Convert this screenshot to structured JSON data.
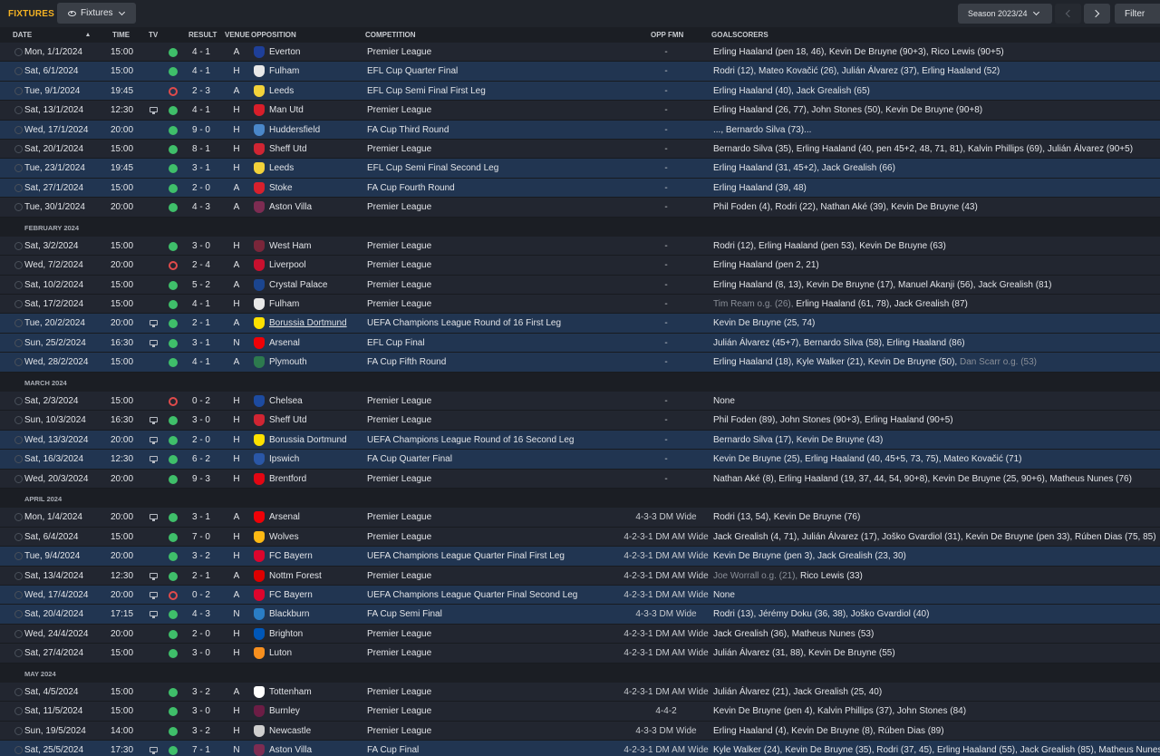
{
  "topbar": {
    "title": "FIXTURES",
    "view_dropdown": "Fixtures",
    "season": "Season 2023/24",
    "filter": "Filter"
  },
  "columns": {
    "date": "DATE",
    "time": "TIME",
    "tv": "TV",
    "result": "RESULT",
    "venue": "VENUE",
    "opposition": "OPPOSITION",
    "competition": "COMPETITION",
    "opp_fmn": "OPP FMN",
    "goalscorers": "GOALSCORERS"
  },
  "team_colors": {
    "Everton": "#1e3f99",
    "Fulham": "#e8e8e8",
    "Leeds": "#f2d23a",
    "Man Utd": "#d81e2a",
    "Huddersfield": "#4a87c9",
    "Sheff Utd": "#d02533",
    "Stoke": "#d8202d",
    "Aston Villa": "#7d2c52",
    "West Ham": "#7a263a",
    "Liverpool": "#c8102e",
    "Crystal Palace": "#1b458f",
    "Borussia Dortmund": "#fde100",
    "Arsenal": "#ef0107",
    "Plymouth": "#2d7a4e",
    "Chelsea": "#1d4ba0",
    "Ipswich": "#2a57a7",
    "Brentford": "#e30613",
    "Wolves": "#fdb913",
    "FC Bayern": "#dc052d",
    "Nottm Forest": "#dd0000",
    "Blackburn": "#2a7dc4",
    "Brighton": "#0057b8",
    "Luton": "#f78f1e",
    "Tottenham": "#ffffff",
    "Burnley": "#6c1d45",
    "Newcastle": "#cfcfcf"
  },
  "fixtures": [
    {
      "type": "match",
      "date": "Mon, 1/1/2024",
      "time": "15:00",
      "tv": false,
      "outcome": "W",
      "score": "4 - 1",
      "venue": "A",
      "opposition": "Everton",
      "competition": "Premier League",
      "opp_fmn": "-",
      "scorers": "Erling Haaland (pen 18, 46), Kevin De Bruyne (90+3), Rico Lewis (90+5)",
      "og": "",
      "scorers_after": "",
      "highlight": false
    },
    {
      "type": "match",
      "date": "Sat, 6/1/2024",
      "time": "15:00",
      "tv": false,
      "outcome": "W",
      "score": "4 - 1",
      "venue": "H",
      "opposition": "Fulham",
      "competition": "EFL Cup Quarter Final",
      "opp_fmn": "-",
      "scorers": "Rodri (12), Mateo Kovačić (26), Julián Álvarez (37), Erling Haaland (52)",
      "og": "",
      "scorers_after": "",
      "highlight": true
    },
    {
      "type": "match",
      "date": "Tue, 9/1/2024",
      "time": "19:45",
      "tv": false,
      "outcome": "L",
      "score": "2 - 3",
      "venue": "A",
      "opposition": "Leeds",
      "competition": "EFL Cup Semi Final First Leg",
      "opp_fmn": "-",
      "scorers": "Erling Haaland (40), Jack Grealish (65)",
      "og": "",
      "scorers_after": "",
      "highlight": true
    },
    {
      "type": "match",
      "date": "Sat, 13/1/2024",
      "time": "12:30",
      "tv": true,
      "outcome": "W",
      "score": "4 - 1",
      "venue": "H",
      "opposition": "Man Utd",
      "competition": "Premier League",
      "opp_fmn": "-",
      "scorers": "Erling Haaland (26, 77), John Stones (50), Kevin De Bruyne (90+8)",
      "og": "",
      "scorers_after": "",
      "highlight": false
    },
    {
      "type": "match",
      "date": "Wed, 17/1/2024",
      "time": "20:00",
      "tv": false,
      "outcome": "W",
      "score": "9 - 0",
      "venue": "H",
      "opposition": "Huddersfield",
      "competition": "FA Cup Third Round",
      "opp_fmn": "-",
      "scorers": "..., Bernardo Silva (73)...",
      "og": "",
      "scorers_after": "",
      "highlight": true
    },
    {
      "type": "match",
      "date": "Sat, 20/1/2024",
      "time": "15:00",
      "tv": false,
      "outcome": "W",
      "score": "8 - 1",
      "venue": "H",
      "opposition": "Sheff Utd",
      "competition": "Premier League",
      "opp_fmn": "-",
      "scorers": "Bernardo Silva (35), Erling Haaland (40, pen 45+2, 48, 71, 81), Kalvin Phillips (69), Julián Álvarez (90+5)",
      "og": "",
      "scorers_after": "",
      "highlight": false
    },
    {
      "type": "match",
      "date": "Tue, 23/1/2024",
      "time": "19:45",
      "tv": false,
      "outcome": "W",
      "score": "3 - 1",
      "venue": "H",
      "opposition": "Leeds",
      "competition": "EFL Cup Semi Final Second Leg",
      "opp_fmn": "-",
      "scorers": "Erling Haaland (31, 45+2), Jack Grealish (66)",
      "og": "",
      "scorers_after": "",
      "highlight": true
    },
    {
      "type": "match",
      "date": "Sat, 27/1/2024",
      "time": "15:00",
      "tv": false,
      "outcome": "W",
      "score": "2 - 0",
      "venue": "A",
      "opposition": "Stoke",
      "competition": "FA Cup Fourth Round",
      "opp_fmn": "-",
      "scorers": "Erling Haaland (39, 48)",
      "og": "",
      "scorers_after": "",
      "highlight": true
    },
    {
      "type": "match",
      "date": "Tue, 30/1/2024",
      "time": "20:00",
      "tv": false,
      "outcome": "W",
      "score": "4 - 3",
      "venue": "A",
      "opposition": "Aston Villa",
      "competition": "Premier League",
      "opp_fmn": "-",
      "scorers": "Phil Foden (4), Rodri (22), Nathan Aké (39), Kevin De Bruyne (43)",
      "og": "",
      "scorers_after": "",
      "highlight": false
    },
    {
      "type": "month",
      "label": "FEBRUARY 2024"
    },
    {
      "type": "match",
      "date": "Sat, 3/2/2024",
      "time": "15:00",
      "tv": false,
      "outcome": "W",
      "score": "3 - 0",
      "venue": "H",
      "opposition": "West Ham",
      "competition": "Premier League",
      "opp_fmn": "-",
      "scorers": "Rodri (12), Erling Haaland (pen 53), Kevin De Bruyne (63)",
      "og": "",
      "scorers_after": "",
      "highlight": false
    },
    {
      "type": "match",
      "date": "Wed, 7/2/2024",
      "time": "20:00",
      "tv": false,
      "outcome": "L",
      "score": "2 - 4",
      "venue": "A",
      "opposition": "Liverpool",
      "competition": "Premier League",
      "opp_fmn": "-",
      "scorers": "Erling Haaland (pen 2, 21)",
      "og": "",
      "scorers_after": "",
      "highlight": false
    },
    {
      "type": "match",
      "date": "Sat, 10/2/2024",
      "time": "15:00",
      "tv": false,
      "outcome": "W",
      "score": "5 - 2",
      "venue": "A",
      "opposition": "Crystal Palace",
      "competition": "Premier League",
      "opp_fmn": "-",
      "scorers": "Erling Haaland (8, 13), Kevin De Bruyne (17), Manuel Akanji (56), Jack Grealish (81)",
      "og": "",
      "scorers_after": "",
      "highlight": false
    },
    {
      "type": "match",
      "date": "Sat, 17/2/2024",
      "time": "15:00",
      "tv": false,
      "outcome": "W",
      "score": "4 - 1",
      "venue": "H",
      "opposition": "Fulham",
      "competition": "Premier League",
      "opp_fmn": "-",
      "scorers": "",
      "og": "Tim Ream o.g. (26), ",
      "scorers_after": "Erling Haaland (61, 78), Jack Grealish (87)",
      "highlight": false
    },
    {
      "type": "match",
      "date": "Tue, 20/2/2024",
      "time": "20:00",
      "tv": true,
      "outcome": "W",
      "score": "2 - 1",
      "venue": "A",
      "opposition": "Borussia Dortmund",
      "competition": "UEFA Champions League Round of 16 First Leg",
      "opp_fmn": "-",
      "scorers": "Kevin De Bruyne (25, 74)",
      "og": "",
      "scorers_after": "",
      "highlight": true,
      "link": true
    },
    {
      "type": "match",
      "date": "Sun, 25/2/2024",
      "time": "16:30",
      "tv": true,
      "outcome": "W",
      "score": "3 - 1",
      "venue": "N",
      "opposition": "Arsenal",
      "competition": "EFL Cup Final",
      "opp_fmn": "-",
      "scorers": "Julián Álvarez (45+7), Bernardo Silva (58), Erling Haaland (86)",
      "og": "",
      "scorers_after": "",
      "highlight": true
    },
    {
      "type": "match",
      "date": "Wed, 28/2/2024",
      "time": "15:00",
      "tv": false,
      "outcome": "W",
      "score": "4 - 1",
      "venue": "A",
      "opposition": "Plymouth",
      "competition": "FA Cup Fifth Round",
      "opp_fmn": "-",
      "scorers": "Erling Haaland (18), Kyle Walker (21), Kevin De Bruyne (50), ",
      "og": "Dan Scarr o.g. (53)",
      "scorers_after": "",
      "highlight": true
    },
    {
      "type": "month",
      "label": "MARCH 2024"
    },
    {
      "type": "match",
      "date": "Sat, 2/3/2024",
      "time": "15:00",
      "tv": false,
      "outcome": "L",
      "score": "0 - 2",
      "venue": "H",
      "opposition": "Chelsea",
      "competition": "Premier League",
      "opp_fmn": "-",
      "scorers": "None",
      "og": "",
      "scorers_after": "",
      "highlight": false
    },
    {
      "type": "match",
      "date": "Sun, 10/3/2024",
      "time": "16:30",
      "tv": true,
      "outcome": "W",
      "score": "3 - 0",
      "venue": "H",
      "opposition": "Sheff Utd",
      "competition": "Premier League",
      "opp_fmn": "-",
      "scorers": "Phil Foden (89), John Stones (90+3), Erling Haaland (90+5)",
      "og": "",
      "scorers_after": "",
      "highlight": false
    },
    {
      "type": "match",
      "date": "Wed, 13/3/2024",
      "time": "20:00",
      "tv": true,
      "outcome": "W",
      "score": "2 - 0",
      "venue": "H",
      "opposition": "Borussia Dortmund",
      "competition": "UEFA Champions League Round of 16 Second Leg",
      "opp_fmn": "-",
      "scorers": "Bernardo Silva (17), Kevin De Bruyne (43)",
      "og": "",
      "scorers_after": "",
      "highlight": true
    },
    {
      "type": "match",
      "date": "Sat, 16/3/2024",
      "time": "12:30",
      "tv": true,
      "outcome": "W",
      "score": "6 - 2",
      "venue": "H",
      "opposition": "Ipswich",
      "competition": "FA Cup Quarter Final",
      "opp_fmn": "-",
      "scorers": "Kevin De Bruyne (25), Erling Haaland (40, 45+5, 73, 75), Mateo Kovačić (71)",
      "og": "",
      "scorers_after": "",
      "highlight": true
    },
    {
      "type": "match",
      "date": "Wed, 20/3/2024",
      "time": "20:00",
      "tv": false,
      "outcome": "W",
      "score": "9 - 3",
      "venue": "H",
      "opposition": "Brentford",
      "competition": "Premier League",
      "opp_fmn": "-",
      "scorers": "Nathan Aké (8), Erling Haaland (19, 37, 44, 54, 90+8), Kevin De Bruyne (25, 90+6), Matheus Nunes (76)",
      "og": "",
      "scorers_after": "",
      "highlight": false
    },
    {
      "type": "month",
      "label": "APRIL 2024"
    },
    {
      "type": "match",
      "date": "Mon, 1/4/2024",
      "time": "20:00",
      "tv": true,
      "outcome": "W",
      "score": "3 - 1",
      "venue": "A",
      "opposition": "Arsenal",
      "competition": "Premier League",
      "opp_fmn": "4-3-3 DM Wide",
      "scorers": "Rodri (13, 54), Kevin De Bruyne (76)",
      "og": "",
      "scorers_after": "",
      "highlight": false
    },
    {
      "type": "match",
      "date": "Sat, 6/4/2024",
      "time": "15:00",
      "tv": false,
      "outcome": "W",
      "score": "7 - 0",
      "venue": "H",
      "opposition": "Wolves",
      "competition": "Premier League",
      "opp_fmn": "4-2-3-1 DM AM Wide",
      "scorers": "Jack Grealish (4, 71), Julián Álvarez (17), Joško Gvardiol (31), Kevin De Bruyne (pen 33), Rúben Dias (75, 85)",
      "og": "",
      "scorers_after": "",
      "highlight": false
    },
    {
      "type": "match",
      "date": "Tue, 9/4/2024",
      "time": "20:00",
      "tv": false,
      "outcome": "W",
      "score": "3 - 2",
      "venue": "H",
      "opposition": "FC Bayern",
      "competition": "UEFA Champions League Quarter Final First Leg",
      "opp_fmn": "4-2-3-1 DM AM Wide",
      "scorers": "Kevin De Bruyne (pen 3), Jack Grealish (23, 30)",
      "og": "",
      "scorers_after": "",
      "highlight": true
    },
    {
      "type": "match",
      "date": "Sat, 13/4/2024",
      "time": "12:30",
      "tv": true,
      "outcome": "W",
      "score": "2 - 1",
      "venue": "A",
      "opposition": "Nottm Forest",
      "competition": "Premier League",
      "opp_fmn": "4-2-3-1 DM AM Wide",
      "scorers": "",
      "og": "Joe Worrall o.g. (21), ",
      "scorers_after": "Rico Lewis (33)",
      "highlight": false
    },
    {
      "type": "match",
      "date": "Wed, 17/4/2024",
      "time": "20:00",
      "tv": true,
      "outcome": "L",
      "score": "0 - 2",
      "venue": "A",
      "opposition": "FC Bayern",
      "competition": "UEFA Champions League Quarter Final Second Leg",
      "opp_fmn": "4-2-3-1 DM AM Wide",
      "scorers": "None",
      "og": "",
      "scorers_after": "",
      "highlight": true
    },
    {
      "type": "match",
      "date": "Sat, 20/4/2024",
      "time": "17:15",
      "tv": true,
      "outcome": "W",
      "score": "4 - 3",
      "venue": "N",
      "opposition": "Blackburn",
      "competition": "FA Cup Semi Final",
      "opp_fmn": "4-3-3 DM Wide",
      "scorers": "Rodri (13), Jérémy Doku (36, 38), Joško Gvardiol (40)",
      "og": "",
      "scorers_after": "",
      "highlight": true
    },
    {
      "type": "match",
      "date": "Wed, 24/4/2024",
      "time": "20:00",
      "tv": false,
      "outcome": "W",
      "score": "2 - 0",
      "venue": "H",
      "opposition": "Brighton",
      "competition": "Premier League",
      "opp_fmn": "4-2-3-1 DM AM Wide",
      "scorers": "Jack Grealish (36), Matheus Nunes (53)",
      "og": "",
      "scorers_after": "",
      "highlight": false
    },
    {
      "type": "match",
      "date": "Sat, 27/4/2024",
      "time": "15:00",
      "tv": false,
      "outcome": "W",
      "score": "3 - 0",
      "venue": "H",
      "opposition": "Luton",
      "competition": "Premier League",
      "opp_fmn": "4-2-3-1 DM AM Wide",
      "scorers": "Julián Álvarez (31, 88), Kevin De Bruyne (55)",
      "og": "",
      "scorers_after": "",
      "highlight": false
    },
    {
      "type": "month",
      "label": "MAY 2024"
    },
    {
      "type": "match",
      "date": "Sat, 4/5/2024",
      "time": "15:00",
      "tv": false,
      "outcome": "W",
      "score": "3 - 2",
      "venue": "A",
      "opposition": "Tottenham",
      "competition": "Premier League",
      "opp_fmn": "4-2-3-1 DM AM Wide",
      "scorers": "Julián Álvarez (21), Jack Grealish (25, 40)",
      "og": "",
      "scorers_after": "",
      "highlight": false
    },
    {
      "type": "match",
      "date": "Sat, 11/5/2024",
      "time": "15:00",
      "tv": false,
      "outcome": "W",
      "score": "3 - 0",
      "venue": "H",
      "opposition": "Burnley",
      "competition": "Premier League",
      "opp_fmn": "4-4-2",
      "scorers": "Kevin De Bruyne (pen 4), Kalvin Phillips (37), John Stones (84)",
      "og": "",
      "scorers_after": "",
      "highlight": false
    },
    {
      "type": "match",
      "date": "Sun, 19/5/2024",
      "time": "14:00",
      "tv": false,
      "outcome": "W",
      "score": "3 - 2",
      "venue": "H",
      "opposition": "Newcastle",
      "competition": "Premier League",
      "opp_fmn": "4-3-3 DM Wide",
      "scorers": "Erling Haaland (4), Kevin De Bruyne (8), Rúben Dias (89)",
      "og": "",
      "scorers_after": "",
      "highlight": false
    },
    {
      "type": "match",
      "date": "Sat, 25/5/2024",
      "time": "17:30",
      "tv": true,
      "outcome": "W",
      "score": "7 - 1",
      "venue": "N",
      "opposition": "Aston Villa",
      "competition": "FA Cup Final",
      "opp_fmn": "4-2-3-1 DM AM Wide",
      "scorers": "Kyle Walker (24), Kevin De Bruyne (35), Rodri (37, 45), Erling Haaland (55), Jack Grealish (85), Matheus Nunes (",
      "og": "",
      "scorers_after": "",
      "highlight": true
    }
  ]
}
